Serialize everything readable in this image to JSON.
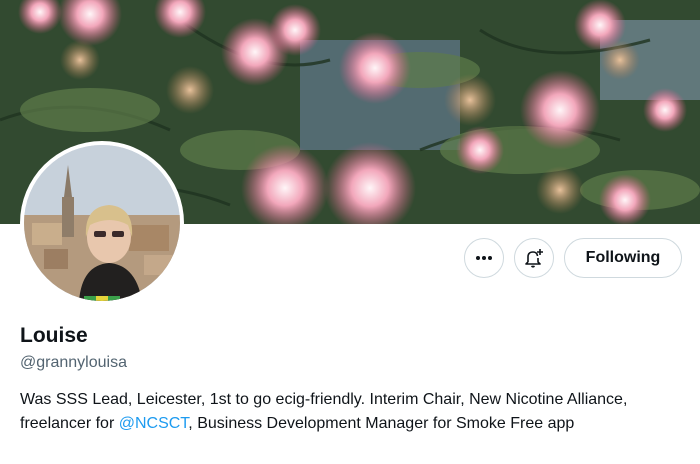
{
  "banner": {
    "alt": ""
  },
  "profile": {
    "name": "Louise",
    "handle": "@grannylouisa",
    "bio": {
      "before": "Was SSS Lead, Leicester, 1st to go ecig-friendly. Interim Chair, New Nicotine Alliance, freelancer for ",
      "mention": "@NCSCT",
      "after": ", Business Development Manager for Smoke Free app"
    }
  },
  "actions": {
    "more_icon": "more-horizontal-icon",
    "notify_icon": "bell-plus-icon",
    "follow_label": "Following"
  },
  "colors": {
    "link": "#1d9bf0",
    "border": "#cfd9de",
    "secondary_text": "#536471"
  }
}
